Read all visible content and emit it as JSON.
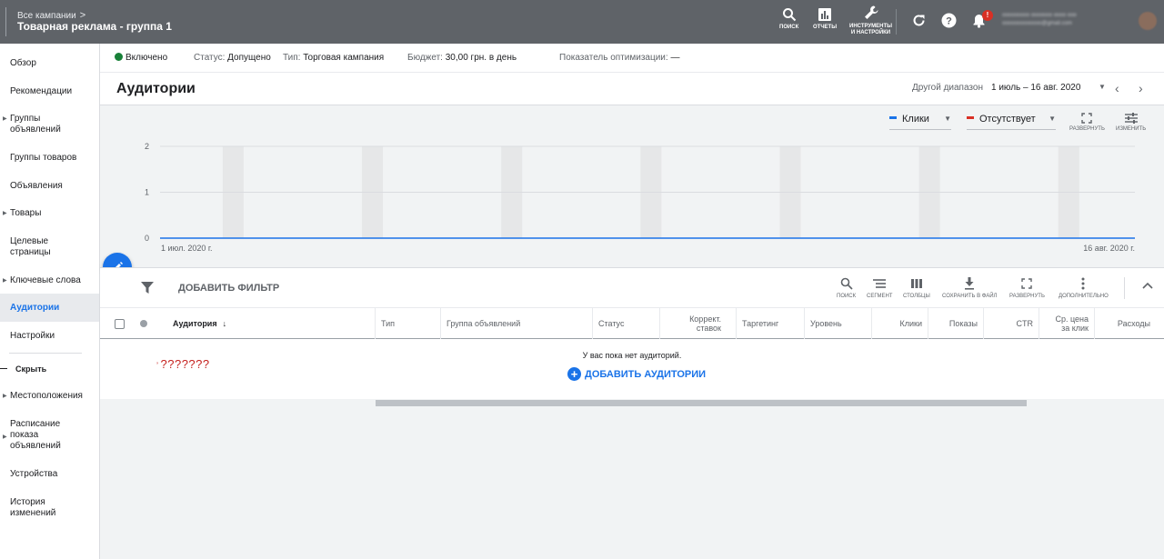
{
  "header": {
    "breadcrumb": "Все кампании",
    "campaign_title": "Товарная реклама - группа 1",
    "tools": [
      {
        "icon": "search-icon",
        "label": "ПОИСК"
      },
      {
        "icon": "reports-icon",
        "label": "ОТЧЕТЫ"
      },
      {
        "icon": "wrench-icon",
        "label_line1": "ИНСТРУМЕНТЫ",
        "label_line2": "И НАСТРОЙКИ"
      }
    ],
    "notification_badge": "!",
    "account_name": "ooooooooo ooooooo oooo ooo",
    "account_email": "ooooooooooooo@gmail.com"
  },
  "sidebar": {
    "items": [
      {
        "label": "Обзор"
      },
      {
        "label": "Рекомендации"
      },
      {
        "label": "Группы объявлений"
      },
      {
        "label": "Группы товаров"
      },
      {
        "label": "Объявления"
      },
      {
        "label": "Товары"
      },
      {
        "label": "Целевые страницы"
      },
      {
        "label": "Ключевые слова"
      },
      {
        "label": "Аудитории"
      },
      {
        "label": "Настройки"
      }
    ],
    "hide_label": "Скрыть",
    "extra_items": [
      {
        "label": "Местоположения"
      },
      {
        "label": "Расписание показа объявлений"
      },
      {
        "label": "Устройства"
      },
      {
        "label": "История изменений"
      }
    ]
  },
  "status_bar": {
    "enabled": "Включено",
    "status_label": "Статус:",
    "status_value": "Допущено",
    "type_label": "Тип:",
    "type_value": "Торговая кампания",
    "budget_label": "Бюджет:",
    "budget_value": "30,00 грн. в день",
    "opt_label": "Показатель оптимизации:",
    "opt_value": "—"
  },
  "page": {
    "title": "Аудитории",
    "range_label": "Другой диапазон",
    "range_value": "1 июль – 16 авг. 2020"
  },
  "chart_controls": {
    "metric1": "Клики",
    "metric2": "Отсутствует",
    "expand_label": "РАЗВЕРНУТЬ",
    "edit_label": "ИЗМЕНИТЬ"
  },
  "chart_data": {
    "type": "line",
    "x_start_label": "1 июл. 2020 г.",
    "x_end_label": "16 авг. 2020 г.",
    "y_ticks": [
      0,
      1,
      2
    ],
    "ylim": [
      0,
      2
    ],
    "series": [
      {
        "name": "Клики",
        "color": "#1a73e8",
        "values": [
          0,
          0
        ]
      }
    ],
    "weekend_bands": 7,
    "grid": true
  },
  "table_toolbar": {
    "add_filter": "ДОБАВИТЬ ФИЛЬТР",
    "tools": [
      {
        "icon": "search-icon",
        "label": "ПОИСК"
      },
      {
        "icon": "segment-icon",
        "label": "СЕГМЕНТ"
      },
      {
        "icon": "columns-icon",
        "label": "СТОЛБЦЫ"
      },
      {
        "icon": "download-icon",
        "label": "СОХРАНИТЬ В ФАЙЛ"
      },
      {
        "icon": "fullscreen-icon",
        "label": "РАЗВЕРНУТЬ"
      },
      {
        "icon": "more-icon",
        "label": "ДОПОЛНИТЕЛЬНО"
      }
    ]
  },
  "table": {
    "columns": [
      {
        "label": "Аудитория"
      },
      {
        "label": "Тип"
      },
      {
        "label": "Группа объявлений"
      },
      {
        "label": "Статус"
      },
      {
        "label_line1": "Коррект.",
        "label_line2": "ставок"
      },
      {
        "label": "Таргетинг"
      },
      {
        "label": "Уровень"
      },
      {
        "label": "Клики"
      },
      {
        "label": "Показы"
      },
      {
        "label": "CTR"
      },
      {
        "label_line1": "Ср. цена",
        "label_line2": "за клик"
      },
      {
        "label": "Расходы"
      }
    ],
    "empty_message": "У вас пока нет аудиторий.",
    "add_audience": "ДОБАВИТЬ АУДИТОРИИ",
    "annotation": "???????"
  },
  "colors": {
    "topbar": "#5f6368",
    "accent": "#1a73e8",
    "enabled_green": "#188038",
    "alert_red": "#d93025"
  }
}
